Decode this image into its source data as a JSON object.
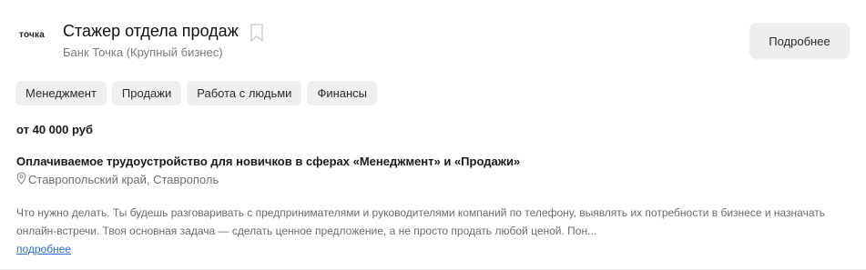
{
  "card": {
    "logo_text": "точка",
    "title": "Стажер отдела продаж",
    "bookmark_icon": "bookmark-icon",
    "company": "Банк Точка (Крупный бизнес)",
    "details_button": "Подробнее",
    "tags": [
      "Менеджмент",
      "Продажи",
      "Работа с людьми",
      "Финансы"
    ],
    "salary": "от 40 000 руб",
    "headline": "Оплачиваемое трудоустройство для новичков в сферах «Менеджмент» и «Продажи»",
    "location_icon": "map-pin-icon",
    "location": "Ставропольский край, Ставрополь",
    "description": "Что нужно делать. Ты будешь разговаривать с предпринимателями и руководителями компаний по телефону, выявлять их потребности в бизнесе и назначать онлайн-встречи. Твоя основная задача — сделать ценное предложение, а не просто продать любой ценой. Пон...",
    "more_link": "подробнее"
  }
}
